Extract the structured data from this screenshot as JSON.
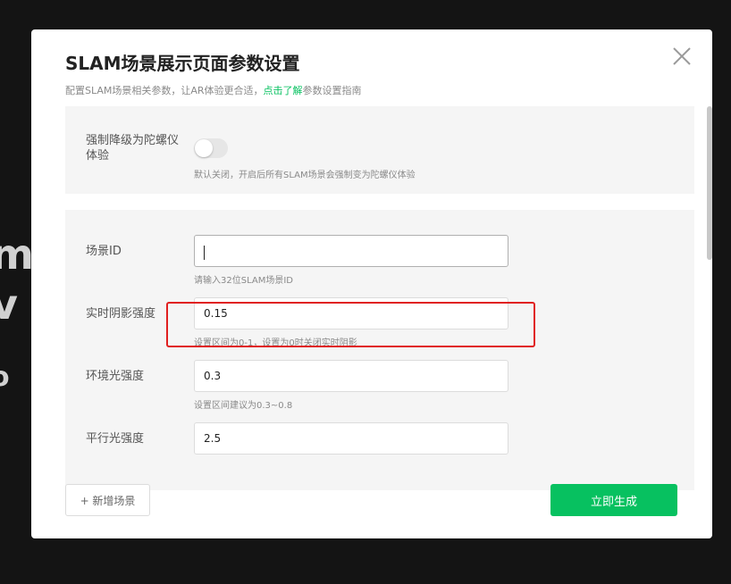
{
  "background": {
    "text_line_1": "m",
    "text_line_2": "v",
    "text_line_3": "o"
  },
  "modal": {
    "title": "SLAM场景展示页面参数设置",
    "subtitle_prefix": "配置SLAM场景相关参数，让AR体验更合适，",
    "subtitle_link": "点击了解",
    "subtitle_suffix": "参数设置指南",
    "close_icon": "close-icon"
  },
  "section_gyro": {
    "label": "强制降级为陀螺仪体验",
    "toggle_on": false,
    "hint": "默认关闭，开启后所有SLAM场景会强制变为陀螺仪体验"
  },
  "fields": [
    {
      "label": "场景ID",
      "value": "",
      "hint": "请输入32位SLAM场景ID"
    },
    {
      "label": "实时阴影强度",
      "value": "0.15",
      "hint": "设置区间为0-1，设置为0时关闭实时阴影"
    },
    {
      "label": "环境光强度",
      "value": "0.3",
      "hint": "设置区间建议为0.3~0.8"
    },
    {
      "label": "平行光强度",
      "value": "2.5",
      "hint": ""
    }
  ],
  "footer": {
    "add_scene_label": "+ 新增场景",
    "generate_label": "立即生成"
  },
  "colors": {
    "accent": "#07c160",
    "highlight": "#e02020"
  }
}
